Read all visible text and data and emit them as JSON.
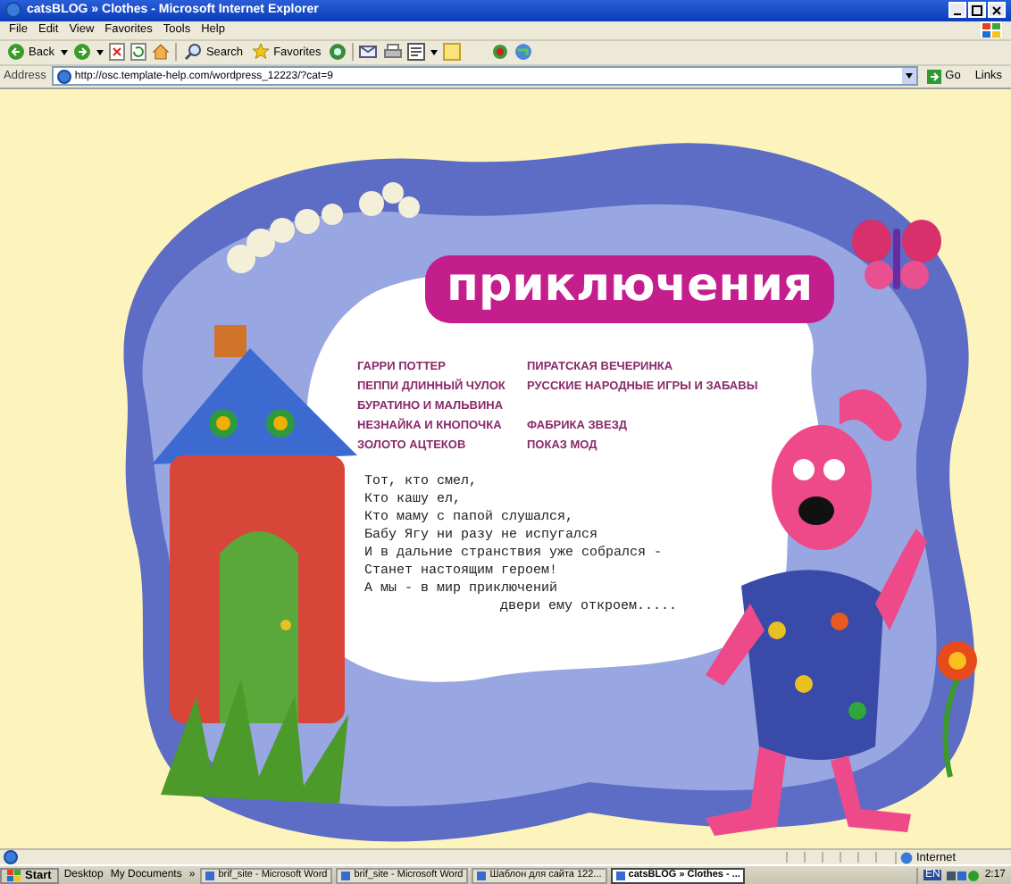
{
  "window": {
    "title": "catsBLOG » Clothes - Microsoft Internet Explorer"
  },
  "menu": [
    "File",
    "Edit",
    "View",
    "Favorites",
    "Tools",
    "Help"
  ],
  "toolbar": {
    "back": "Back",
    "search": "Search",
    "favorites": "Favorites"
  },
  "address": {
    "label": "Address",
    "url": "http://osc.template-help.com/wordpress_12223/?cat=9",
    "go": "Go",
    "links": "Links"
  },
  "page": {
    "title": "приключения",
    "menu_rows": [
      {
        "left": "ГАРРИ ПОТТЕР",
        "right": "ПИРАТСКАЯ ВЕЧЕРИНКА"
      },
      {
        "left": "ПЕППИ ДЛИННЫЙ ЧУЛОК",
        "right": "РУССКИЕ НАРОДНЫЕ ИГРЫ И ЗАБАВЫ"
      },
      {
        "left": "БУРАТИНО И МАЛЬВИНА"
      },
      {
        "left": "НЕЗНАЙКА И КНОПОЧКА",
        "right": "ФАБРИКА ЗВЕЗД"
      },
      {
        "left": "ЗОЛОТО АЦТЕКОВ",
        "right": "ПОКАЗ МОД"
      }
    ],
    "poem": [
      {
        "kind": "line",
        "text": "Тот, кто смел,"
      },
      {
        "kind": "line",
        "text": "Кто кашу ел,"
      },
      {
        "kind": "line",
        "text": "Кто маму с папой слушался,"
      },
      {
        "kind": "line",
        "text": "Бабу Ягу ни разу не испугался"
      },
      {
        "kind": "line",
        "text": "И в дальние странствия уже собрался -"
      },
      {
        "kind": "line",
        "text": "Станет настоящим героем!"
      },
      {
        "kind": "line",
        "text": "А мы - в мир приключений"
      },
      {
        "kind": "indent",
        "text": "двери ему откроем....."
      }
    ]
  },
  "status_bar": {
    "zone": "Internet"
  },
  "taskbar": {
    "start": "Start",
    "quick": [
      "Desktop",
      "My Documents"
    ],
    "more": "»",
    "tasks": [
      {
        "label": "brif_site - Microsoft Word",
        "selected": false
      },
      {
        "label": "brif_site - Microsoft Word",
        "selected": false
      },
      {
        "label": "Шаблон для сайта 122...",
        "selected": false
      },
      {
        "label": "catsBLOG » Clothes - ...",
        "selected": true
      }
    ],
    "language": "EN",
    "clock": "2:17"
  }
}
